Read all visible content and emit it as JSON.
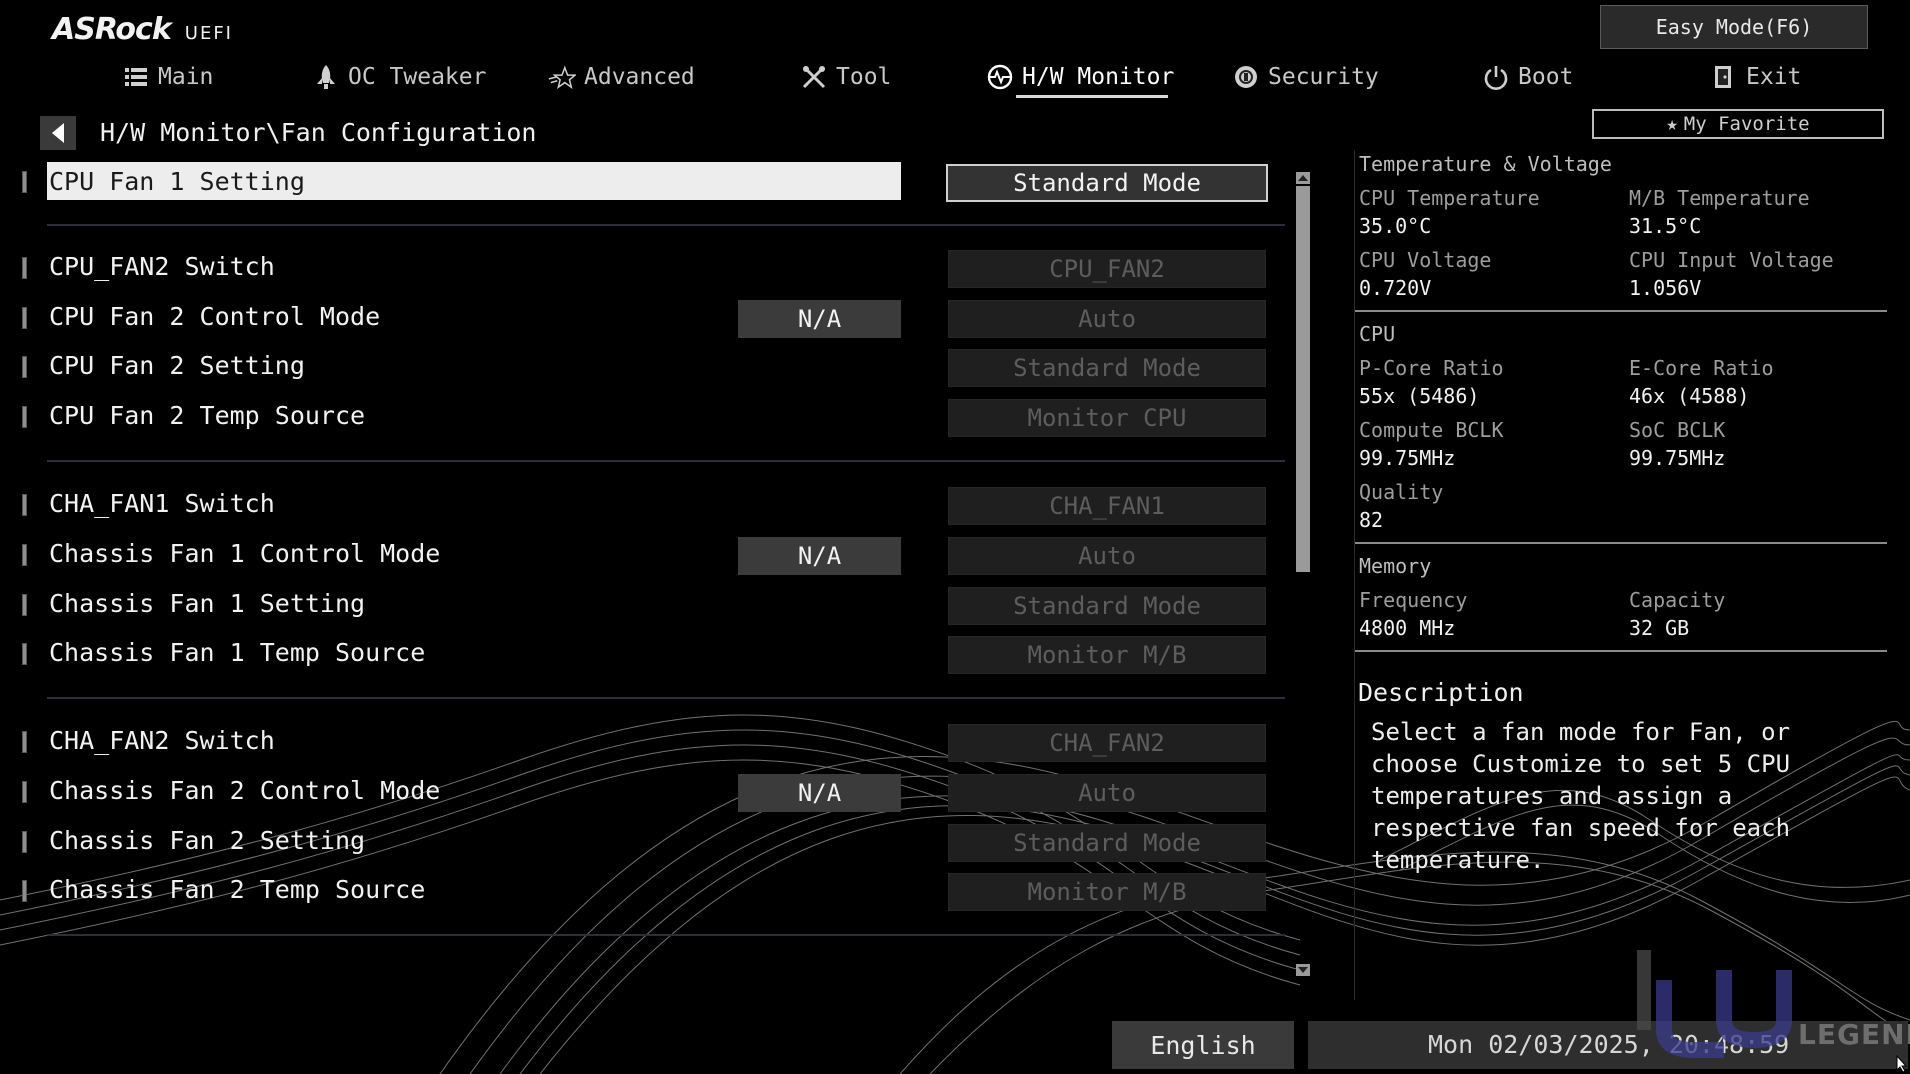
{
  "brand": {
    "name": "ASRock",
    "subtitle": "UEFI"
  },
  "header": {
    "easy_mode_label": "Easy Mode(F6)",
    "favorite_label": "My Favorite"
  },
  "nav": {
    "tabs": [
      {
        "label": "Main",
        "icon": "list-icon"
      },
      {
        "label": "OC Tweaker",
        "icon": "rocket-icon"
      },
      {
        "label": "Advanced",
        "icon": "star-icon"
      },
      {
        "label": "Tool",
        "icon": "tools-icon"
      },
      {
        "label": "H/W Monitor",
        "icon": "monitor-icon",
        "active": true
      },
      {
        "label": "Security",
        "icon": "shield-icon"
      },
      {
        "label": "Boot",
        "icon": "power-icon"
      },
      {
        "label": "Exit",
        "icon": "exit-icon"
      }
    ]
  },
  "breadcrumb": "H/W Monitor\\Fan Configuration",
  "settings": [
    {
      "label": "CPU Fan 1 Setting",
      "value": "Standard Mode",
      "na": null,
      "selected": true
    },
    {
      "label": "CPU_FAN2 Switch",
      "value": "CPU_FAN2",
      "na": null
    },
    {
      "label": "CPU Fan 2 Control Mode",
      "value": "Auto",
      "na": "N/A"
    },
    {
      "label": "CPU Fan 2 Setting",
      "value": "Standard Mode",
      "na": null
    },
    {
      "label": "CPU Fan 2 Temp Source",
      "value": "Monitor CPU",
      "na": null
    },
    {
      "label": "CHA_FAN1 Switch",
      "value": "CHA_FAN1",
      "na": null
    },
    {
      "label": "Chassis Fan 1 Control Mode",
      "value": "Auto",
      "na": "N/A"
    },
    {
      "label": "Chassis Fan 1 Setting",
      "value": "Standard Mode",
      "na": null
    },
    {
      "label": "Chassis Fan 1 Temp Source",
      "value": "Monitor M/B",
      "na": null
    },
    {
      "label": "CHA_FAN2 Switch",
      "value": "CHA_FAN2",
      "na": null
    },
    {
      "label": "Chassis Fan 2 Control Mode",
      "value": "Auto",
      "na": "N/A"
    },
    {
      "label": "Chassis Fan 2 Setting",
      "value": "Standard Mode",
      "na": null
    },
    {
      "label": "Chassis Fan 2 Temp Source",
      "value": "Monitor M/B",
      "na": null
    }
  ],
  "info": {
    "temp_voltage": {
      "title": "Temperature & Voltage",
      "cpu_temp_label": "CPU Temperature",
      "cpu_temp": "35.0°C",
      "mb_temp_label": "M/B Temperature",
      "mb_temp": "31.5°C",
      "cpu_voltage_label": "CPU Voltage",
      "cpu_voltage": "0.720V",
      "cpu_input_voltage_label": "CPU Input Voltage",
      "cpu_input_voltage": "1.056V"
    },
    "cpu": {
      "title": "CPU",
      "pcore_label": "P-Core Ratio",
      "pcore": "55x (5486)",
      "ecore_label": "E-Core Ratio",
      "ecore": "46x (4588)",
      "bclk_label": "Compute BCLK",
      "bclk": "99.75MHz",
      "soc_label": "SoC BCLK",
      "soc": "99.75MHz",
      "quality_label": "Quality",
      "quality": "82"
    },
    "memory": {
      "title": "Memory",
      "freq_label": "Frequency",
      "freq": "4800 MHz",
      "cap_label": "Capacity",
      "cap": "32 GB"
    }
  },
  "description": {
    "title": "Description",
    "text": "Select a fan mode for Fan, or choose Customize to set 5 CPU temperatures and assign a respective fan speed for each temperature."
  },
  "footer": {
    "language": "English",
    "datetime": "Mon 02/03/2025, 20:48:59",
    "watermark": "LEGEND"
  }
}
